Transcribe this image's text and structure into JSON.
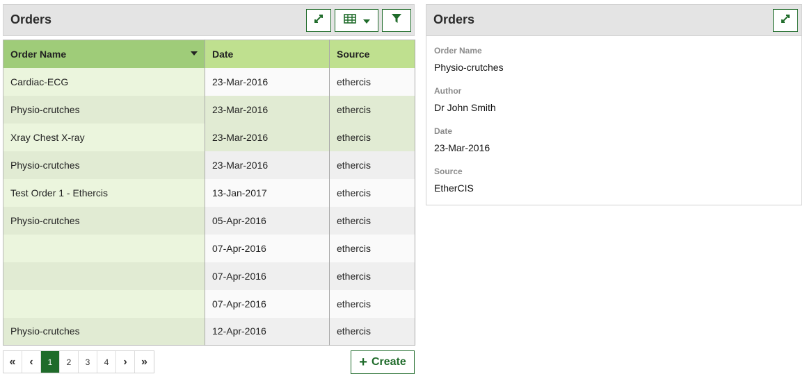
{
  "left_panel": {
    "title": "Orders",
    "buttons": [
      "expand-icon",
      "table-icon",
      "filter-icon"
    ]
  },
  "table": {
    "columns": [
      "Order Name",
      "Date",
      "Source"
    ],
    "rows": [
      {
        "name": "Cardiac-ECG",
        "date": "23-Mar-2016",
        "source": "ethercis"
      },
      {
        "name": "Physio-crutches",
        "date": "23-Mar-2016",
        "source": "ethercis"
      },
      {
        "name": "Xray Chest X-ray",
        "date": "23-Mar-2016",
        "source": "ethercis"
      },
      {
        "name": "Physio-crutches",
        "date": "23-Mar-2016",
        "source": "ethercis"
      },
      {
        "name": "Test Order 1 - Ethercis",
        "date": "13-Jan-2017",
        "source": "ethercis"
      },
      {
        "name": "Physio-crutches",
        "date": "05-Apr-2016",
        "source": "ethercis"
      },
      {
        "name": "",
        "date": "07-Apr-2016",
        "source": "ethercis"
      },
      {
        "name": "",
        "date": "07-Apr-2016",
        "source": "ethercis"
      },
      {
        "name": "",
        "date": "07-Apr-2016",
        "source": "ethercis"
      },
      {
        "name": "Physio-crutches",
        "date": "12-Apr-2016",
        "source": "ethercis"
      }
    ]
  },
  "pagination": {
    "first": "«",
    "prev": "‹",
    "pages": [
      "1",
      "2",
      "3",
      "4"
    ],
    "next": "›",
    "last": "»",
    "current": "1"
  },
  "create_button": {
    "icon": "plus-icon",
    "label": "Create"
  },
  "right_panel": {
    "title": "Orders",
    "fields": [
      {
        "label": "Order Name",
        "value": "Physio-crutches"
      },
      {
        "label": "Author",
        "value": "Dr John Smith"
      },
      {
        "label": "Date",
        "value": "23-Mar-2016"
      },
      {
        "label": "Source",
        "value": "EtherCIS"
      }
    ]
  },
  "colors": {
    "accent": "#1f6b2a",
    "header_green": "#bfe08f",
    "sorted_header_green": "#9fcc79"
  }
}
